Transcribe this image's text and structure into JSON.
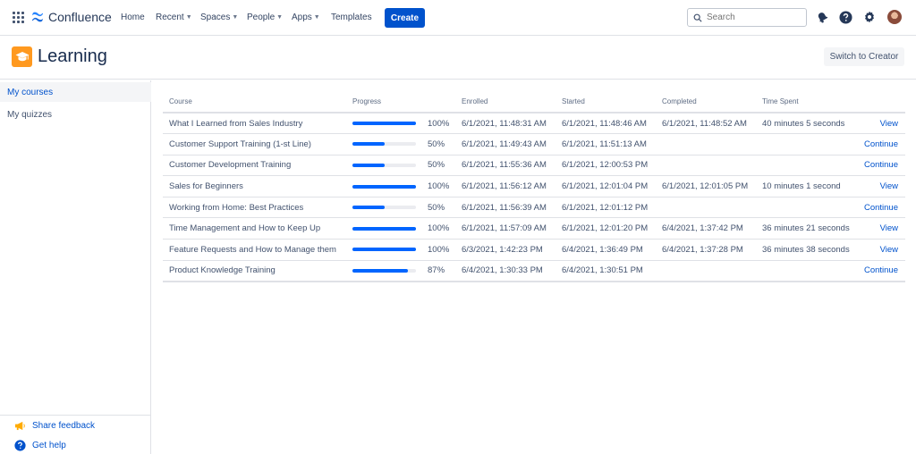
{
  "nav": {
    "brand": "Confluence",
    "items": [
      {
        "label": "Home",
        "dropdown": false
      },
      {
        "label": "Recent",
        "dropdown": true
      },
      {
        "label": "Spaces",
        "dropdown": true
      },
      {
        "label": "People",
        "dropdown": true
      },
      {
        "label": "Apps",
        "dropdown": true
      },
      {
        "label": "Templates",
        "dropdown": false
      }
    ],
    "create_label": "Create",
    "search_placeholder": "Search"
  },
  "header": {
    "title": "Learning",
    "switch_label": "Switch to Creator"
  },
  "sidebar": {
    "items": [
      {
        "label": "My courses",
        "active": true
      },
      {
        "label": "My quizzes",
        "active": false
      }
    ],
    "share_feedback": "Share feedback",
    "get_help": "Get help"
  },
  "table": {
    "headers": [
      "Course",
      "Progress",
      "Enrolled",
      "Started",
      "Completed",
      "Time Spent",
      ""
    ],
    "rows": [
      {
        "course": "What I Learned from Sales Industry",
        "progress": 100,
        "progress_label": "100%",
        "enrolled": "6/1/2021, 11:48:31 AM",
        "started": "6/1/2021, 11:48:46 AM",
        "completed": "6/1/2021, 11:48:52 AM",
        "time_spent": "40 minutes 5 seconds",
        "action": "View"
      },
      {
        "course": "Customer Support Training (1-st Line)",
        "progress": 50,
        "progress_label": "50%",
        "enrolled": "6/1/2021, 11:49:43 AM",
        "started": "6/1/2021, 11:51:13 AM",
        "completed": "",
        "time_spent": "",
        "action": "Continue"
      },
      {
        "course": "Customer Development Training",
        "progress": 50,
        "progress_label": "50%",
        "enrolled": "6/1/2021, 11:55:36 AM",
        "started": "6/1/2021, 12:00:53 PM",
        "completed": "",
        "time_spent": "",
        "action": "Continue"
      },
      {
        "course": "Sales for Beginners",
        "progress": 100,
        "progress_label": "100%",
        "enrolled": "6/1/2021, 11:56:12 AM",
        "started": "6/1/2021, 12:01:04 PM",
        "completed": "6/1/2021, 12:01:05 PM",
        "time_spent": "10 minutes 1 second",
        "action": "View"
      },
      {
        "course": "Working from Home: Best Practices",
        "progress": 50,
        "progress_label": "50%",
        "enrolled": "6/1/2021, 11:56:39 AM",
        "started": "6/1/2021, 12:01:12 PM",
        "completed": "",
        "time_spent": "",
        "action": "Continue"
      },
      {
        "course": "Time Management and How to Keep Up",
        "progress": 100,
        "progress_label": "100%",
        "enrolled": "6/1/2021, 11:57:09 AM",
        "started": "6/1/2021, 12:01:20 PM",
        "completed": "6/4/2021, 1:37:42 PM",
        "time_spent": "36 minutes 21 seconds",
        "action": "View"
      },
      {
        "course": "Feature Requests and How to Manage them",
        "progress": 100,
        "progress_label": "100%",
        "enrolled": "6/3/2021, 1:42:23 PM",
        "started": "6/4/2021, 1:36:49 PM",
        "completed": "6/4/2021, 1:37:28 PM",
        "time_spent": "36 minutes 38 seconds",
        "action": "View"
      },
      {
        "course": "Product Knowledge Training",
        "progress": 87,
        "progress_label": "87%",
        "enrolled": "6/4/2021, 1:30:33 PM",
        "started": "6/4/2021, 1:30:51 PM",
        "completed": "",
        "time_spent": "",
        "action": "Continue"
      }
    ]
  },
  "colors": {
    "accent": "#0052cc",
    "progress_fill": "#0065ff",
    "app_icon": "#ff991f"
  },
  "icons": [
    "app-switcher-icon",
    "confluence-logo-icon",
    "search-icon",
    "notifications-icon",
    "help-icon",
    "settings-icon",
    "graduation-cap-icon",
    "megaphone-icon"
  ]
}
